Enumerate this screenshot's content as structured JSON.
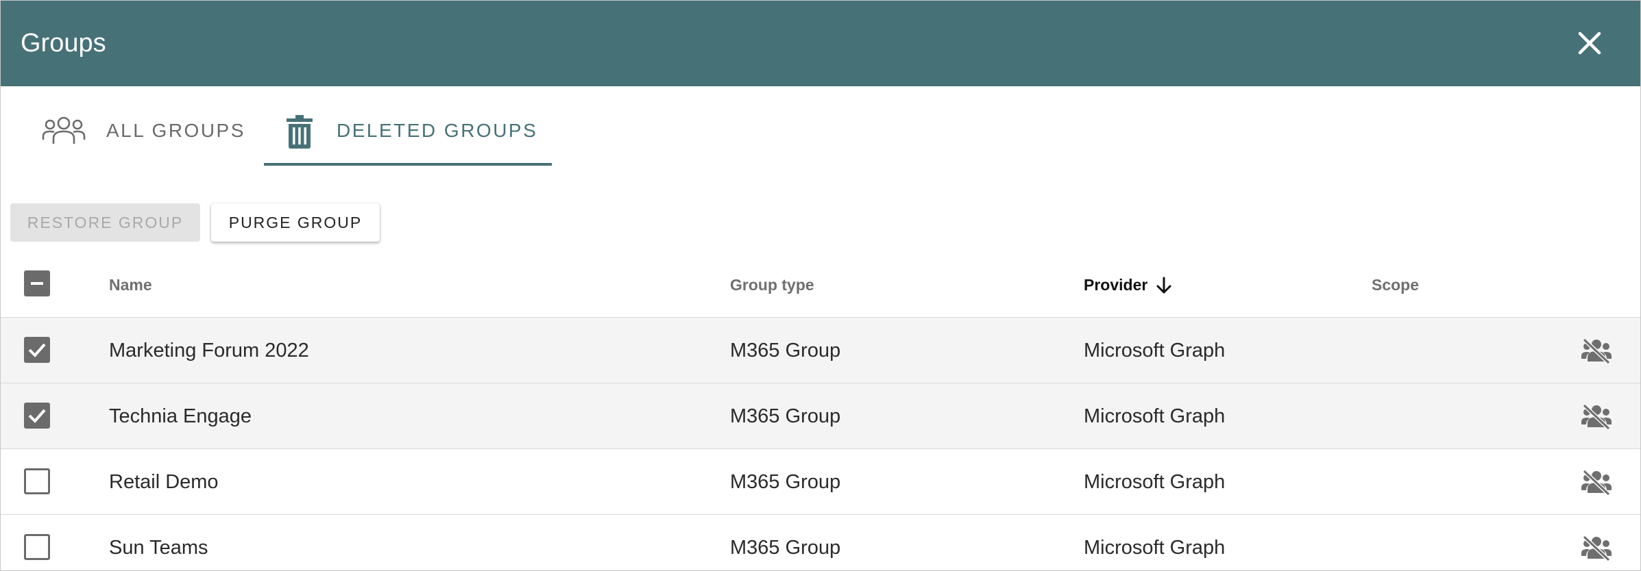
{
  "header": {
    "title": "Groups",
    "close_icon": "close-icon"
  },
  "tabs": [
    {
      "label": "ALL GROUPS",
      "icon": "people-icon",
      "active": false
    },
    {
      "label": "DELETED GROUPS",
      "icon": "trash-icon",
      "active": true
    }
  ],
  "actions": {
    "restore_label": "RESTORE GROUP",
    "purge_label": "PURGE GROUP"
  },
  "table": {
    "columns": {
      "name": "Name",
      "group_type": "Group type",
      "provider": "Provider",
      "scope": "Scope"
    },
    "sort": {
      "column": "Provider",
      "direction": "descending"
    },
    "select_all_state": "indeterminate",
    "rows": [
      {
        "checked": true,
        "name": "Marketing Forum 2022",
        "group_type": "M365 Group",
        "provider": "Microsoft Graph",
        "scope": "",
        "icon": "people-off-icon"
      },
      {
        "checked": true,
        "name": "Technia Engage",
        "group_type": "M365 Group",
        "provider": "Microsoft Graph",
        "scope": "",
        "icon": "people-off-icon"
      },
      {
        "checked": false,
        "name": "Retail Demo",
        "group_type": "M365 Group",
        "provider": "Microsoft Graph",
        "scope": "",
        "icon": "people-off-icon"
      },
      {
        "checked": false,
        "name": "Sun Teams",
        "group_type": "M365 Group",
        "provider": "Microsoft Graph",
        "scope": "",
        "icon": "people-off-icon"
      }
    ]
  },
  "colors": {
    "accent": "#467177",
    "header_bg": "#467177",
    "selected_row": "#f4f4f4",
    "checkbox": "#6b6b6b"
  }
}
